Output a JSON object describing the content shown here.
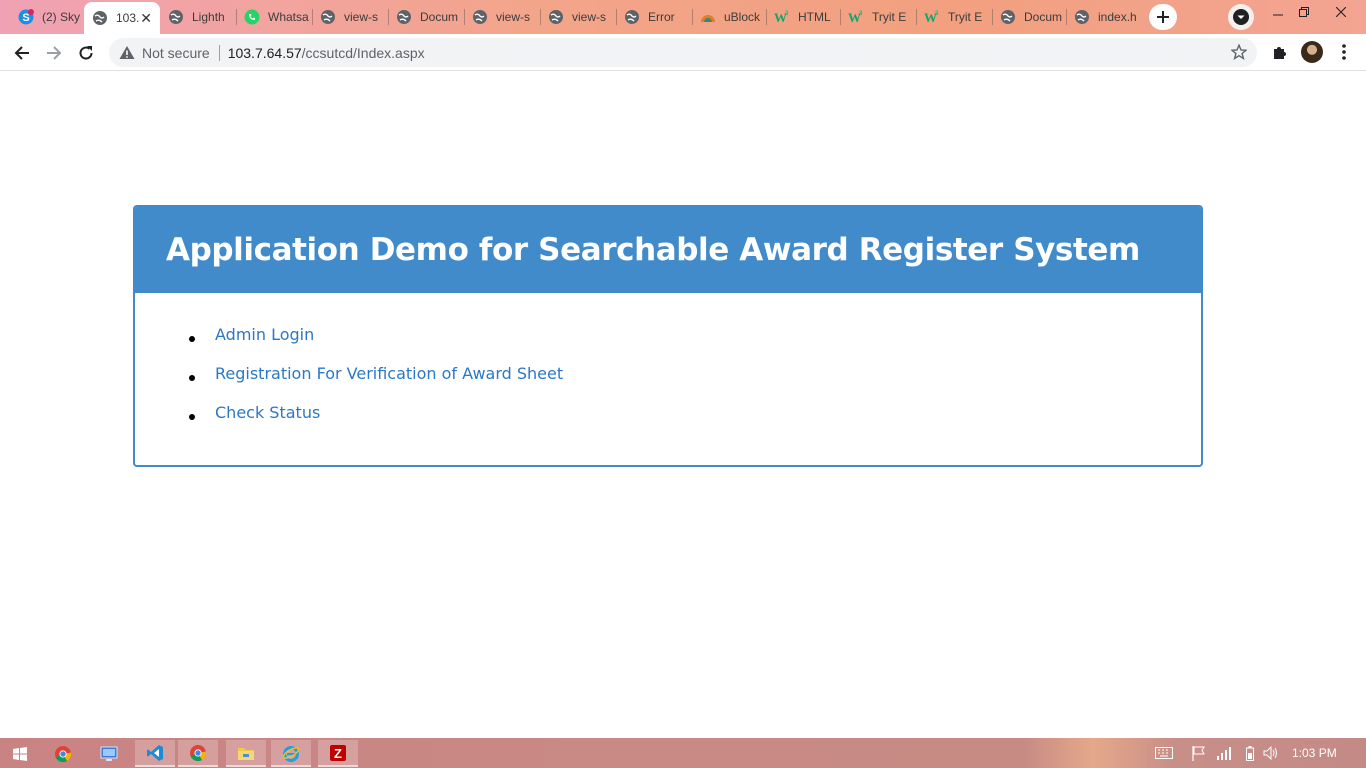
{
  "browser": {
    "tabs": [
      {
        "title": "(2) Sky",
        "icon": "skype-icon",
        "active": false
      },
      {
        "title": "103.7.64.57/ccsutcd/Index.aspx",
        "display": "103.",
        "icon": "globe-icon",
        "active": true
      },
      {
        "title": "Lighth",
        "icon": "globe-icon",
        "active": false
      },
      {
        "title": "Whatsa",
        "icon": "whatsapp-icon",
        "active": false
      },
      {
        "title": "view-s",
        "icon": "globe-icon",
        "active": false
      },
      {
        "title": "Docum",
        "icon": "globe-icon",
        "active": false
      },
      {
        "title": "view-s",
        "icon": "globe-icon",
        "active": false
      },
      {
        "title": "view-s",
        "icon": "globe-icon",
        "active": false
      },
      {
        "title": "Error",
        "icon": "globe-icon",
        "active": false
      },
      {
        "title": "uBlock",
        "icon": "ublock-icon",
        "active": false
      },
      {
        "title": "HTML",
        "icon": "w3schools-icon",
        "active": false
      },
      {
        "title": "Tryit E",
        "icon": "w3schools-icon",
        "active": false
      },
      {
        "title": "Tryit E",
        "icon": "w3schools-icon",
        "active": false
      },
      {
        "title": "Docum",
        "icon": "globe-icon",
        "active": false
      },
      {
        "title": "index.h",
        "icon": "globe-icon",
        "active": false
      }
    ],
    "address": {
      "security_label": "Not secure",
      "host": "103.7.64.57",
      "path": "/ccsutcd/Index.aspx"
    }
  },
  "page": {
    "heading": "Application Demo for Searchable Award Register System",
    "links": [
      {
        "label": "Admin Login"
      },
      {
        "label": "Registration For Verification of Award Sheet"
      },
      {
        "label": "Check Status"
      }
    ]
  },
  "taskbar": {
    "apps": [
      {
        "name": "start-icon"
      },
      {
        "name": "chrome-icon"
      },
      {
        "name": "remote-desktop-icon"
      },
      {
        "name": "vscode-icon"
      },
      {
        "name": "chrome-icon"
      },
      {
        "name": "file-explorer-icon"
      },
      {
        "name": "internet-explorer-icon"
      },
      {
        "name": "filezilla-icon"
      }
    ],
    "clock": "1:03 PM"
  },
  "colors": {
    "panel_primary": "#428bca",
    "link": "#2a78c7"
  }
}
